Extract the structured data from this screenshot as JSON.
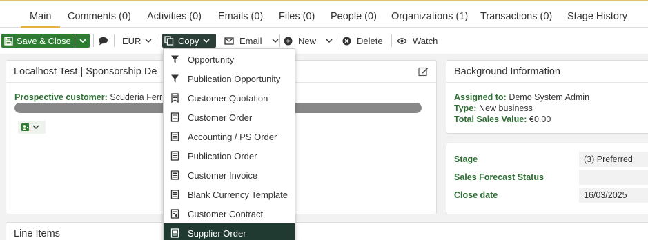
{
  "tabs": [
    {
      "label": "Main",
      "active": true
    },
    {
      "label": "Comments (0)"
    },
    {
      "label": "Activities (0)"
    },
    {
      "label": "Emails (0)"
    },
    {
      "label": "Files (0)"
    },
    {
      "label": "People (0)"
    },
    {
      "label": "Organizations (1)"
    },
    {
      "label": "Transactions (0)"
    },
    {
      "label": "Stage History"
    }
  ],
  "toolbar": {
    "save_close": "Save & Close",
    "currency": "EUR",
    "copy": "Copy",
    "email": "Email",
    "new": "New",
    "delete": "Delete",
    "watch": "Watch"
  },
  "main_panel": {
    "title": "Localhost Test | Sponsorship De",
    "customer_label": "Prospective customer:",
    "customer_value": "Scuderia Ferr"
  },
  "background": {
    "title": "Background Information",
    "assigned_label": "Assigned to:",
    "assigned_value": "Demo System Admin",
    "type_label": "Type:",
    "type_value": "New business",
    "total_label": "Total Sales Value:",
    "total_value": "€0.00"
  },
  "stage_panel": {
    "stage_label": "Stage",
    "stage_value": "(3) Preferred",
    "forecast_label": "Sales Forecast Status",
    "forecast_value": "",
    "close_label": "Close date",
    "close_value": "16/03/2025"
  },
  "line_items": {
    "title": "Line Items"
  },
  "copy_menu": {
    "items": [
      {
        "label": "Opportunity",
        "icon": "filter-icon"
      },
      {
        "label": "Publication Opportunity",
        "icon": "filter-icon"
      },
      {
        "label": "Customer Quotation",
        "icon": "quote-doc-icon"
      },
      {
        "label": "Customer Order",
        "icon": "doc-icon"
      },
      {
        "label": "Accounting / PS Order",
        "icon": "doc-icon"
      },
      {
        "label": "Publication Order",
        "icon": "doc-icon"
      },
      {
        "label": "Customer Invoice",
        "icon": "invoice-icon"
      },
      {
        "label": "Blank Currency Template",
        "icon": "invoice-icon"
      },
      {
        "label": "Customer Contract",
        "icon": "contract-icon"
      },
      {
        "label": "Supplier Order",
        "icon": "supplier-doc-icon",
        "highlighted": true
      }
    ]
  },
  "colors": {
    "accent_green": "#2e7d32",
    "label_green": "#2e6e34",
    "dark_button": "#2b3f38",
    "menu_highlight": "#213a31",
    "tab_underline": "#e3b23c"
  }
}
